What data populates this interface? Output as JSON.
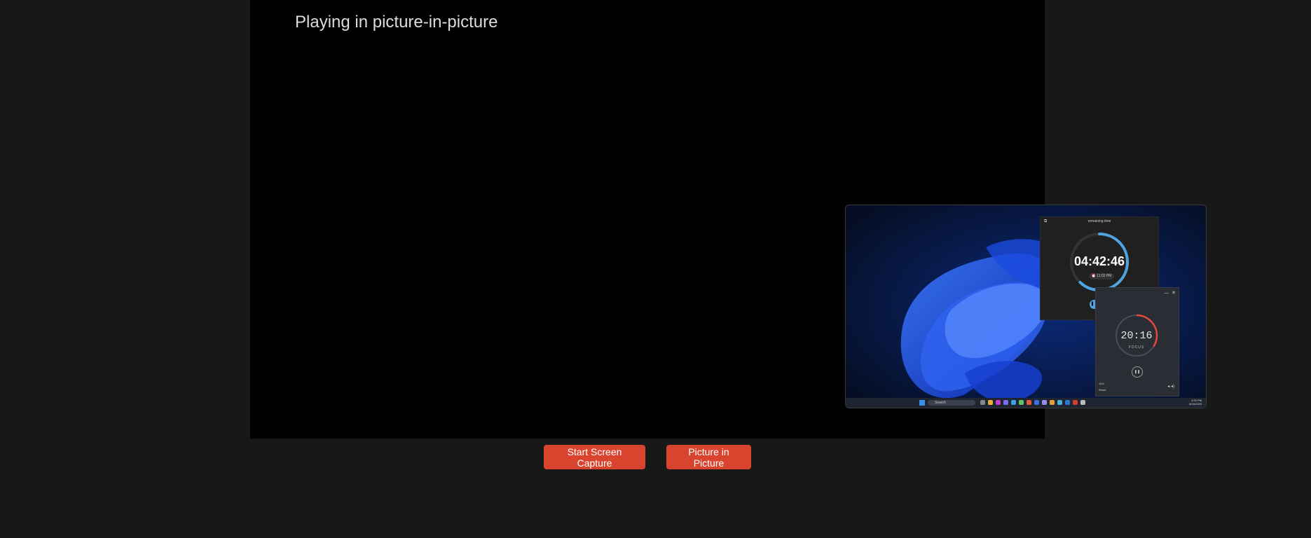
{
  "video": {
    "status_text": "Playing in picture-in-picture"
  },
  "controls": {
    "start_capture_label": "Start Screen Capture",
    "pip_label": "Picture in Picture"
  },
  "pip": {
    "timer_main": {
      "title": "remaining time",
      "time": "04:42:46",
      "alarm": "⏰ 11:02 PM",
      "progress": 0.62
    },
    "timer_focus": {
      "time": "20:16",
      "mode": "FOCUS",
      "count": "10/4",
      "reset": "Reset",
      "progress": 0.34
    },
    "taskbar": {
      "search": "Search",
      "clock_time": "4:20 PM",
      "clock_date": "6/16/2023"
    }
  },
  "colors": {
    "page_bg": "#181818",
    "video_bg": "#000000",
    "button_bg": "#d9442e",
    "timer_accent": "#4fa3e0",
    "focus_accent": "#e5483e"
  }
}
